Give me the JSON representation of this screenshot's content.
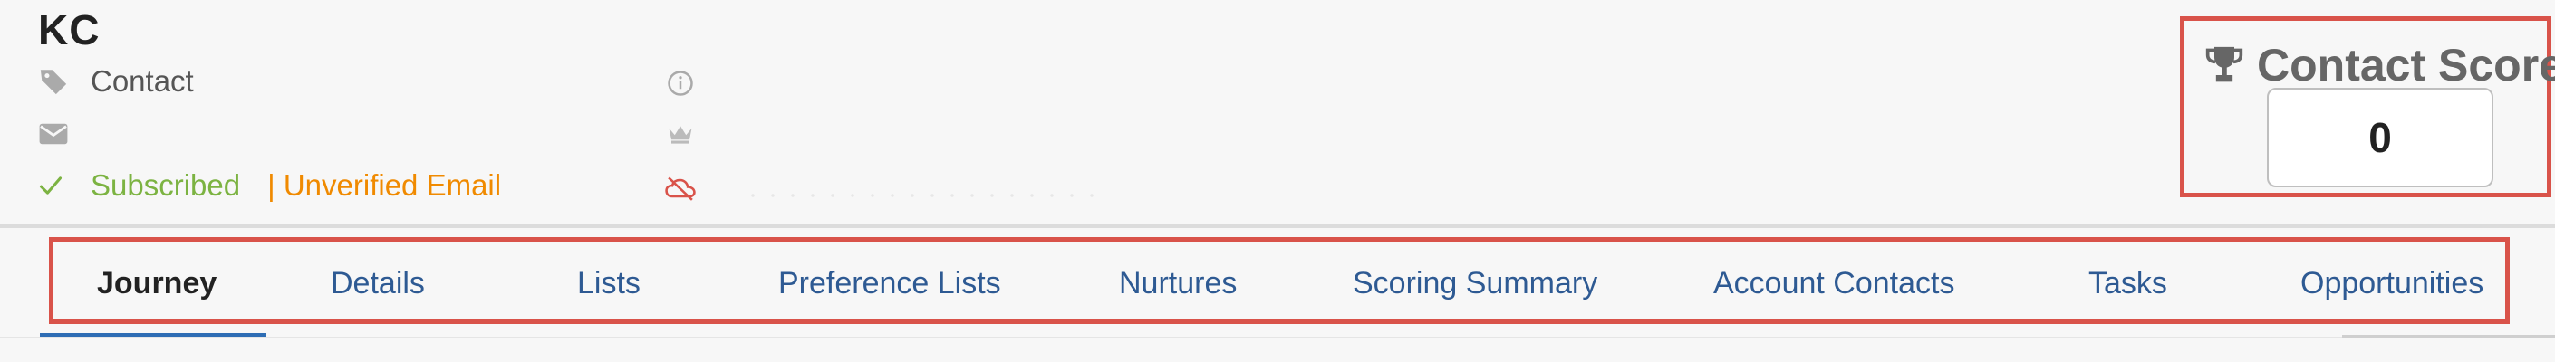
{
  "contact": {
    "name": "KC",
    "type_label": "Contact",
    "email": "",
    "subscription_status": "Subscribed",
    "email_status": "| Unverified Email"
  },
  "score": {
    "title": "Contact Score",
    "value": "0"
  },
  "tabs": [
    {
      "label": "Journey",
      "active": true
    },
    {
      "label": "Details",
      "active": false
    },
    {
      "label": "Lists",
      "active": false
    },
    {
      "label": "Preference Lists",
      "active": false
    },
    {
      "label": "Nurtures",
      "active": false
    },
    {
      "label": "Scoring Summary",
      "active": false
    },
    {
      "label": "Account Contacts",
      "active": false
    },
    {
      "label": "Tasks",
      "active": false
    },
    {
      "label": "Opportunities",
      "active": false
    }
  ],
  "icons": {
    "type": "tag-icon",
    "email": "envelope-icon",
    "subscribed": "checkmark-icon",
    "info": "info-icon",
    "crown": "crown-icon",
    "sync": "cloud-off-icon",
    "score": "trophy-icon"
  },
  "colors": {
    "highlight_border": "#d9534a",
    "tab_link": "#2e5a93",
    "subscribed": "#7cb342",
    "unverified": "#f08a00",
    "sync_off": "#d9534a"
  }
}
